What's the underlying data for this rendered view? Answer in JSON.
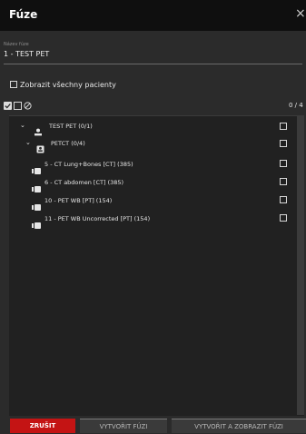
{
  "window": {
    "title": "Fúze",
    "close_glyph": "×"
  },
  "name_field": {
    "label": "Název fúze",
    "value": "1 - TEST PET"
  },
  "show_all": {
    "label": "Zobrazit všechny pacienty",
    "checked": false
  },
  "toolbar": {
    "icons": [
      "check-all-icon",
      "uncheck-all-icon",
      "clear-icon"
    ],
    "count": "0 / 4"
  },
  "tree": {
    "patient": {
      "label": "TEST PET (0/1)",
      "icon": "person-icon",
      "expanded": true,
      "checked": false
    },
    "study": {
      "label": "PETCT (0/4)",
      "icon": "study-badge-icon",
      "expanded": true,
      "checked": false
    },
    "series": [
      {
        "label": "5 - CT Lung+Bones [CT] (385)",
        "checked": false
      },
      {
        "label": "6 - CT abdomen [CT] (385)",
        "checked": false
      },
      {
        "label": "10 - PET WB [PT] (154)",
        "checked": false
      },
      {
        "label": "11 - PET WB Uncorrected [PT] (154)",
        "checked": false
      }
    ]
  },
  "footer": {
    "cancel": "ZRUŠIT",
    "create": "VYTVOŘIT FÚZI",
    "create_show": "VYTVOŘIT A ZOBRAZIT FÚZI"
  },
  "colors": {
    "accent": "#c41414",
    "background": "#2b2b2b",
    "titlebar": "#0f0f0f"
  }
}
